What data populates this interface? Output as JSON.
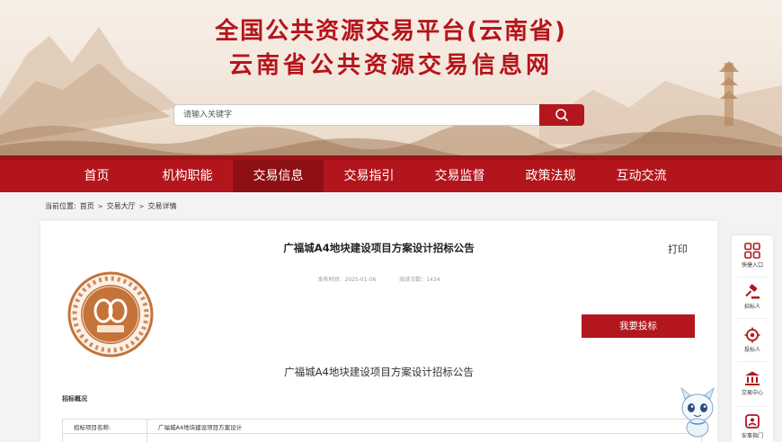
{
  "header": {
    "title_line1": "全国公共资源交易平台(云南省)",
    "title_line2": "云南省公共资源交易信息网"
  },
  "search": {
    "placeholder": "请输入关键字",
    "button_icon": "search-icon"
  },
  "nav": {
    "items": [
      {
        "label": "首页"
      },
      {
        "label": "机构职能"
      },
      {
        "label": "交易信息",
        "active": true
      },
      {
        "label": "交易指引"
      },
      {
        "label": "交易监督"
      },
      {
        "label": "政策法规"
      },
      {
        "label": "互动交流"
      }
    ]
  },
  "breadcrumb": {
    "prefix": "当前位置:",
    "items": [
      "首页",
      "交易大厅",
      "交易详情"
    ],
    "separator": ">"
  },
  "announcement": {
    "title": "广福城A4地块建设项目方案设计招标公告",
    "print_label": "打印",
    "publish_time": "发布时间：2025-01-06",
    "view_count": "阅读次数：1434",
    "bid_button": "我要投标",
    "subtitle": "广福城A4地块建设项目方案设计招标公告",
    "section_label": "招标概况",
    "table": [
      {
        "key": "招标项目名称:",
        "value": "广福城A4地块建设项目方案设计"
      }
    ]
  },
  "seal": {
    "icon": "trading-center-seal-icon",
    "sub_text": "数据中"
  },
  "quick_bar": {
    "items": [
      {
        "label": "快捷入口",
        "icon": "grid-icon"
      },
      {
        "label": "招标人",
        "icon": "gavel-icon"
      },
      {
        "label": "投标人",
        "icon": "target-icon"
      },
      {
        "label": "交易中心",
        "icon": "building-icon"
      },
      {
        "label": "安事指门",
        "icon": "shield-icon"
      }
    ]
  },
  "colors": {
    "brand_red": "#b2161c",
    "nav_active": "#8e1014",
    "seal_orange": "#c4733a"
  }
}
